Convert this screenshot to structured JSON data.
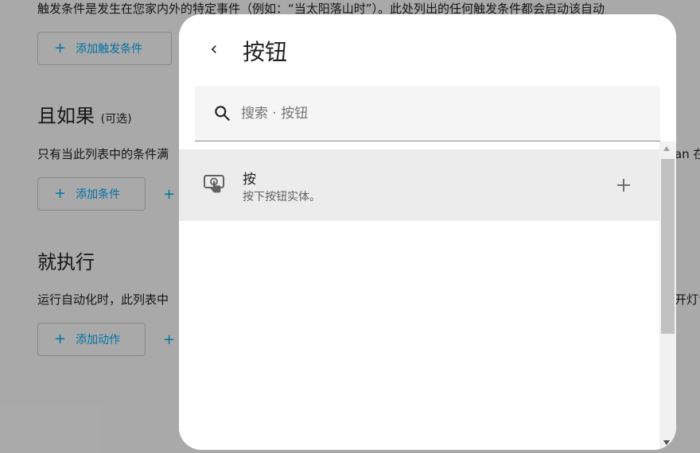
{
  "background": {
    "trigger_description": "触发条件是发生在您家内外的特定事件（例如：“当太阳落山时”）。此处列出的任何触发条件都会启动该自动",
    "add_trigger_label": "添加触发条件",
    "condition_heading": "且如果",
    "condition_optional": "(可选)",
    "condition_description_left": "只有当此列表中的条件满",
    "condition_description_right": "an 在",
    "add_condition_label": "添加条件",
    "action_heading": "就执行",
    "action_description_left": "运行自动化时，此列表中",
    "action_description_right": "开灯”",
    "add_action_label": "添加动作",
    "plus_glyph": "+"
  },
  "dialog": {
    "title": "按钮",
    "search": {
      "placeholder": "搜索 · 按钮",
      "value": ""
    },
    "items": [
      {
        "title": "按",
        "description": "按下按钮实体。",
        "icon": "gesture-tap-button-icon"
      }
    ]
  },
  "colors": {
    "accent": "#03a9f4",
    "dialog_background": "#ffffff",
    "selected_item": "#ececec",
    "scrim": "rgba(0,0,0,0.32)"
  }
}
